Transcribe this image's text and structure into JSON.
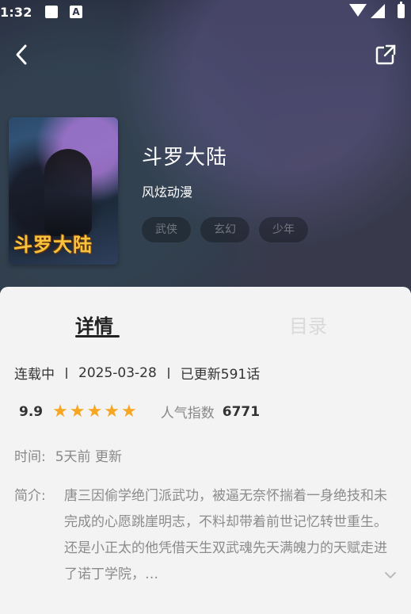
{
  "status_bar": {
    "time": "1:32",
    "icons": [
      "image-icon",
      "a-icon",
      "wifi-icon",
      "signal-icon",
      "battery-icon"
    ]
  },
  "book": {
    "title": "斗罗大陆",
    "author": "风炫动漫",
    "cover_logo": "斗罗大陆",
    "tags": [
      "武侠",
      "玄幻",
      "少年"
    ]
  },
  "tabs": {
    "detail": "详情",
    "catalog": "目录",
    "active": "detail"
  },
  "meta": {
    "status": "连载中",
    "date": "2025-03-28",
    "updated": "已更新591话"
  },
  "rating": {
    "score": "9.9",
    "stars": 5,
    "stars_text": "★★★★★",
    "popularity_label": "人气指数",
    "popularity_value": "6771"
  },
  "update_time": {
    "label": "时间:",
    "value": "5天前 更新"
  },
  "intro": {
    "label": "简介:",
    "text": "唐三因偷学绝门派武功，被逼无奈怀揣着一身绝技和未完成的心愿跳崖明志，不料却带着前世记忆转世重生。还是小正太的他凭借天生双武魂先天满魄力的天赋走进了诺丁学院，…"
  },
  "colors": {
    "accent_star": "#f6a623",
    "text_dark": "#222222",
    "text_muted": "#888888",
    "panel_bg": "#f3f3f3"
  }
}
